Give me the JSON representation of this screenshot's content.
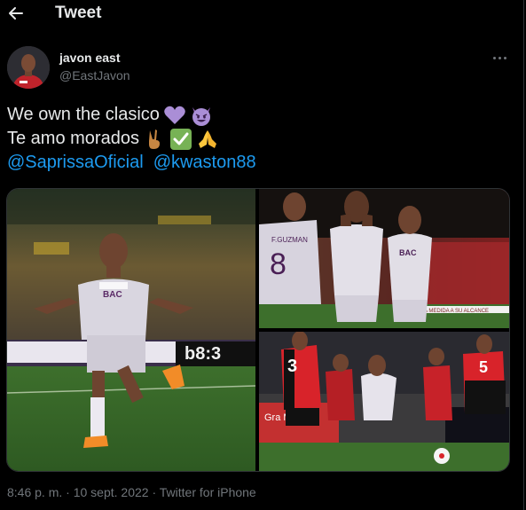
{
  "header": {
    "title": "Tweet",
    "back_icon": "arrow-left-icon"
  },
  "author": {
    "display_name": "javon east",
    "handle": "@EastJavon"
  },
  "tweet": {
    "line1_text": "We own the clasico",
    "line1_emojis": [
      "purple-heart-emoji",
      "smiling-imp-emoji"
    ],
    "line2_text": "Te amo morados",
    "line2_emojis": [
      "victory-hand-emoji",
      "check-mark-emoji",
      "folded-hands-emoji"
    ],
    "mentions": [
      "@SaprissaOficial",
      "@kwaston88"
    ]
  },
  "media": {
    "photo1_scoreboard": "b8:3",
    "photo1_sponsor": "BAC",
    "photo2_sponsor": "BAC",
    "photo2_shirt_name": "F.GUZMAN",
    "photo2_shirt_number": "8",
    "photo2_banner": "A MEDIDA A SU ALCANCE",
    "photo3_number_left": "3",
    "photo3_number_right": "5",
    "photo3_ad": "Gra\nMu"
  },
  "meta": {
    "time": "8:46 p. m.",
    "separator1": " · ",
    "date": "10 sept. 2022",
    "separator2": " · ",
    "source": "Twitter for iPhone"
  },
  "colors": {
    "background": "#000000",
    "text_primary": "#e7e9ea",
    "text_secondary": "#71767b",
    "link": "#1d9bf0",
    "saprissa_purple": "#6b2a74",
    "alajuelense_red": "#d8232a"
  }
}
